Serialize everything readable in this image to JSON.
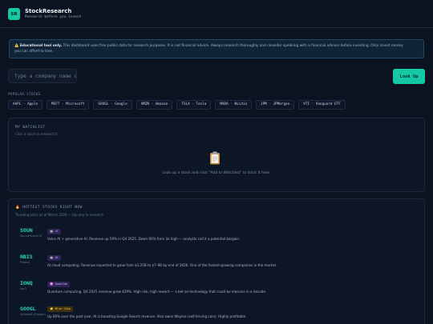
{
  "header": {
    "logo": "SR",
    "title": "StockResearch",
    "tagline": "Research before you invest"
  },
  "notice": {
    "icon": "warning-icon",
    "bold": "⚠️ Educational tool only.",
    "line1": " This dashboard uses free public data for research purposes. It is not financial advice. Always research thoroughly and consider speaking with a financial advisor before investing. Only invest money",
    "line2": "you can afford to lose."
  },
  "search": {
    "placeholder": "Type a company name or ticker",
    "button": "Look Up"
  },
  "popular": {
    "label": "POPULAR STOCKS",
    "chips": [
      "AAPL · Apple",
      "MSFT · Microsoft",
      "GOOGL · Google",
      "AMZN · Amazon",
      "TSLA · Tesla",
      "NVDA · Nvidia",
      "JPM · JPMorgan",
      "VTI · Vanguard ETF"
    ]
  },
  "watchlist": {
    "title": "MY WATCHLIST",
    "subtitle": "Click a stock to research it",
    "empty": "Look up a stock and click \"Add to Watchlist\" to track it here."
  },
  "hottest": {
    "title": "🔥 HOTTEST STOCKS RIGHT NOW",
    "subtitle": "Trending picks as of March 2026 — tap any to research",
    "items": [
      {
        "ticker": "SOUN",
        "name": "SoundHound AI",
        "tag": "🤖 AI",
        "desc": "Voice AI + generative AI. Revenue up 59% in Q4 2025. Down 60% from its high — analysts call it a potential bargain."
      },
      {
        "ticker": "NBIS",
        "name": "Nebius",
        "tag": "🤖 AI",
        "desc": "AI cloud computing. Revenue expected to grow from $1.25B to $7–9B by end of 2026. One of the fastest-growing companies in the market."
      },
      {
        "ticker": "IONQ",
        "name": "IonQ",
        "tag": "⚛️ Quantum",
        "desc": "Quantum computing. Q4 2025 revenue grew 429%. High risk, high reward — a bet on technology that could be massive in a decade."
      },
      {
        "ticker": "GOOGL",
        "name": "Alphabet (Google)",
        "tag": "⭐ Blue Chip",
        "desc": "Up 66% over the past year. AI is boosting Google Search revenue. Also owns Waymo (self-driving cars). Highly profitable."
      }
    ]
  }
}
